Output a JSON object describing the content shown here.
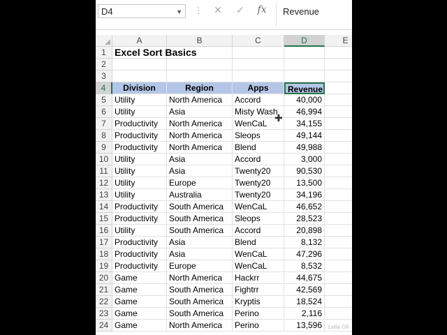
{
  "formula_bar": {
    "name_box": "D4",
    "cancel_icon": "✕",
    "enter_icon": "✓",
    "fx_label": "fx",
    "content": "Revenue"
  },
  "columns": [
    "A",
    "B",
    "C",
    "D",
    "E"
  ],
  "selected_column": "D",
  "selected_row": "4",
  "title": "Excel Sort Basics",
  "headers": [
    "Division",
    "Region",
    "Apps",
    "Revenue"
  ],
  "rows": [
    [
      "Utility",
      "North America",
      "Accord",
      "40,000"
    ],
    [
      "Utility",
      "Asia",
      "Misty Wash",
      "46,994"
    ],
    [
      "Productivity",
      "North America",
      "WenCaL",
      "34,155"
    ],
    [
      "Productivity",
      "North America",
      "Sleops",
      "49,144"
    ],
    [
      "Productivity",
      "North America",
      "Blend",
      "49,988"
    ],
    [
      "Utility",
      "Asia",
      "Accord",
      "3,000"
    ],
    [
      "Utility",
      "Asia",
      "Twenty20",
      "90,530"
    ],
    [
      "Utility",
      "Europe",
      "Twenty20",
      "13,500"
    ],
    [
      "Utility",
      "Australia",
      "Twenty20",
      "34,196"
    ],
    [
      "Productivity",
      "South America",
      "WenCaL",
      "46,652"
    ],
    [
      "Productivity",
      "South America",
      "Sleops",
      "28,523"
    ],
    [
      "Utility",
      "South America",
      "Accord",
      "20,898"
    ],
    [
      "Productivity",
      "Asia",
      "Blend",
      "8,132"
    ],
    [
      "Productivity",
      "Asia",
      "WenCaL",
      "47,296"
    ],
    [
      "Productivity",
      "Europe",
      "WenCaL",
      "8,532"
    ],
    [
      "Game",
      "North America",
      "Hackrr",
      "44,675"
    ],
    [
      "Game",
      "South America",
      "Fightrr",
      "42,569"
    ],
    [
      "Game",
      "South America",
      "Kryptis",
      "18,524"
    ],
    [
      "Game",
      "South America",
      "Perino",
      "2,116"
    ],
    [
      "Game",
      "North America",
      "Perino",
      "13,596"
    ]
  ],
  "watermark": "Leila Gh"
}
